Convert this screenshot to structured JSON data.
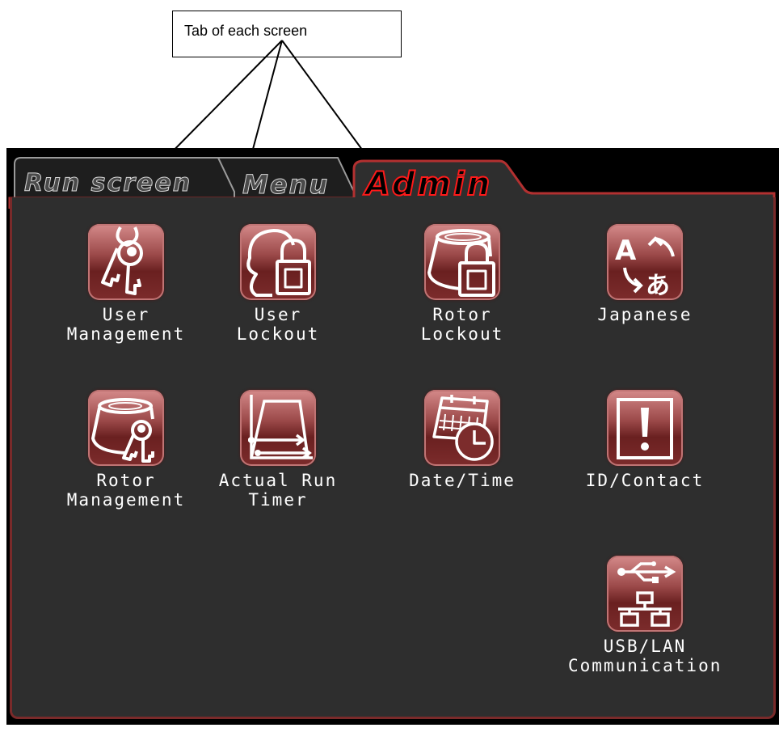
{
  "callout": {
    "text": "Tab of each screen"
  },
  "tabs": [
    {
      "label": "Run screen",
      "active": false
    },
    {
      "label": "Menu",
      "active": false
    },
    {
      "label": "Admin",
      "active": true
    }
  ],
  "tiles": [
    {
      "label": "User\nManagement",
      "icon": "keys-icon"
    },
    {
      "label": "User\nLockout",
      "icon": "user-lock-icon"
    },
    {
      "label": "Rotor\nLockout",
      "icon": "rotor-lock-icon"
    },
    {
      "label": "Japanese",
      "icon": "language-icon"
    },
    {
      "label": "Rotor\nManagement",
      "icon": "rotor-keys-icon"
    },
    {
      "label": "Actual Run\nTimer",
      "icon": "run-timer-icon"
    },
    {
      "label": "Date/Time",
      "icon": "calendar-clock-icon"
    },
    {
      "label": "ID/Contact",
      "icon": "exclamation-icon"
    },
    {
      "label": "USB/LAN\nCommunication",
      "icon": "usb-lan-icon"
    }
  ],
  "colors": {
    "accent": "#ff1a1a",
    "panel": "#2e2e2e",
    "tile": "#8a3a3a"
  }
}
